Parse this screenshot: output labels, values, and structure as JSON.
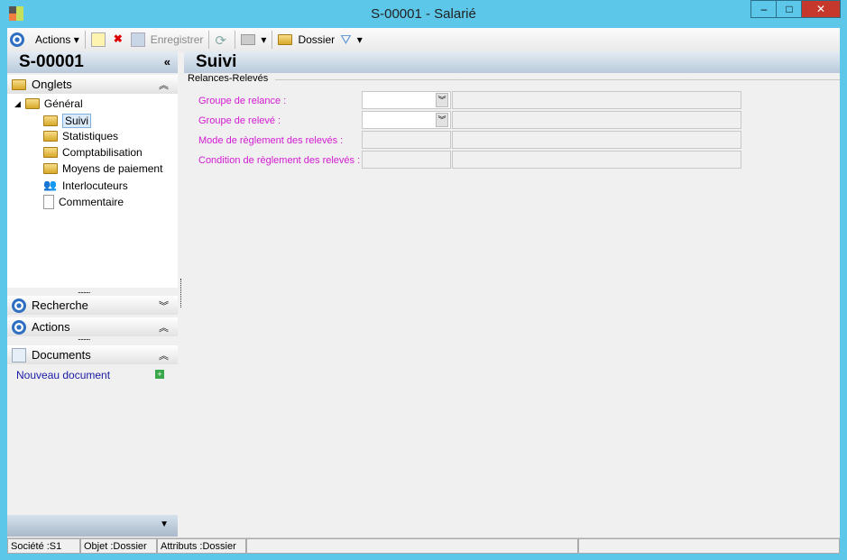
{
  "window": {
    "title": "S-00001 -  Salarié"
  },
  "toolbar": {
    "actions": "Actions",
    "save": "Enregistrer",
    "dossier": "Dossier"
  },
  "left": {
    "header": "S-00001",
    "onglets": "Onglets",
    "tree": {
      "root": "Général",
      "items": [
        "Suivi",
        "Statistiques",
        "Comptabilisation",
        "Moyens de paiement",
        "Interlocuteurs",
        "Commentaire"
      ]
    },
    "recherche": "Recherche",
    "actions": "Actions",
    "documents": "Documents",
    "new_doc": "Nouveau document"
  },
  "main": {
    "title": "Suivi",
    "group": "Relances-Relevés",
    "fields": [
      {
        "label": "Groupe de relance :"
      },
      {
        "label": "Groupe de relevé :"
      },
      {
        "label": "Mode de règlement des relevés :"
      },
      {
        "label": "Condition de règlement des relevés :"
      }
    ]
  },
  "status": {
    "societe": "Société :S1",
    "objet": "Objet :Dossier",
    "attributs": "Attributs :Dossier"
  }
}
